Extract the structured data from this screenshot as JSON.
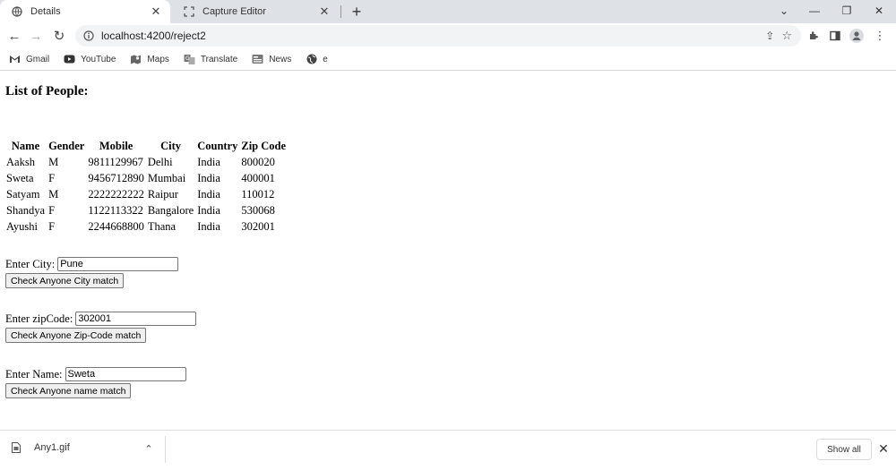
{
  "browser": {
    "tabs": [
      {
        "title": "Details",
        "active": true,
        "favicon": "globe-icon"
      },
      {
        "title": "Capture Editor",
        "active": false,
        "favicon": "capture-icon"
      }
    ],
    "new_tab": "+",
    "window_controls": {
      "chevron": "⌄",
      "minimize": "—",
      "restore": "❐",
      "close": "✕"
    },
    "url": "localhost:4200/reject2",
    "bookmarks": [
      {
        "label": "Gmail",
        "icon": "gmail-icon"
      },
      {
        "label": "YouTube",
        "icon": "youtube-icon"
      },
      {
        "label": "Maps",
        "icon": "maps-icon"
      },
      {
        "label": "Translate",
        "icon": "translate-icon"
      },
      {
        "label": "News",
        "icon": "news-icon"
      },
      {
        "label": "e",
        "icon": "globe-icon"
      }
    ]
  },
  "page": {
    "heading": "List of People:",
    "table": {
      "headers": [
        "Name",
        "Gender",
        "Mobile",
        "City",
        "Country",
        "Zip Code"
      ],
      "rows": [
        [
          "Aaksh",
          "M",
          "9811129967",
          "Delhi",
          "India",
          "800020"
        ],
        [
          "Sweta",
          "F",
          "9456712890",
          "Mumbai",
          "India",
          "400001"
        ],
        [
          "Satyam",
          "M",
          "2222222222",
          "Raipur",
          "India",
          "110012"
        ],
        [
          "Shandya",
          "F",
          "1122113322",
          "Bangalore",
          "India",
          "530068"
        ],
        [
          "Ayushi",
          "F",
          "2244668800",
          "Thana",
          "India",
          "302001"
        ]
      ]
    },
    "city_form": {
      "label": "Enter City:",
      "value": "Pune",
      "button": "Check Anyone City match"
    },
    "zip_form": {
      "label": "Enter zipCode:",
      "value": "302001",
      "button": "Check Anyone Zip-Code match"
    },
    "name_form": {
      "label": "Enter Name:",
      "value": "Sweta",
      "button": "Check Anyone name match"
    }
  },
  "downloads": {
    "file_name": "Any1.gif",
    "show_all": "Show all"
  }
}
